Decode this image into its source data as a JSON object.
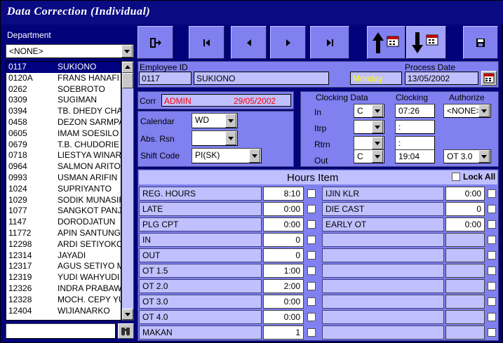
{
  "window": {
    "title": "Data Correction (Individual)"
  },
  "sidebar": {
    "department_label": "Department",
    "department_value": "<NONE>",
    "search_value": "",
    "employees": [
      {
        "id": "0117",
        "name": "SUKIONO"
      },
      {
        "id": "0120A",
        "name": "FRANS   HANAFI"
      },
      {
        "id": "0262",
        "name": "SOEBROTO"
      },
      {
        "id": "0309",
        "name": "SUGIMAN"
      },
      {
        "id": "0394",
        "name": "TB. DHEDY CHAN"
      },
      {
        "id": "0458",
        "name": "DEZON SARMPAE"
      },
      {
        "id": "0605",
        "name": "IMAM SOESILO"
      },
      {
        "id": "0679",
        "name": "T.B. CHUDORIE F"
      },
      {
        "id": "0718",
        "name": "LIESTYA WINAR"
      },
      {
        "id": "0964",
        "name": "SALMON ARITON"
      },
      {
        "id": "0993",
        "name": "USMAN ARIFIN"
      },
      {
        "id": "1024",
        "name": "SUPRIYANTO"
      },
      {
        "id": "1029",
        "name": "SODIK MUNASIR"
      },
      {
        "id": "1077",
        "name": "SANGKOT PANJA"
      },
      {
        "id": "1147",
        "name": "DORODJATUN"
      },
      {
        "id": "11772",
        "name": "APIN SANTUNG"
      },
      {
        "id": "12298",
        "name": "ARDI SETIYOKO"
      },
      {
        "id": "12314",
        "name": "JAYADI"
      },
      {
        "id": "12317",
        "name": "AGUS SETIYO M"
      },
      {
        "id": "12319",
        "name": "YUDI WAHYUDI"
      },
      {
        "id": "12326",
        "name": "INDRA PRABAWA"
      },
      {
        "id": "12328",
        "name": "MOCH. CEPY YU"
      },
      {
        "id": "12404",
        "name": "WIJIANARKO"
      }
    ]
  },
  "employee": {
    "id_label": "Employee ID",
    "id": "0117",
    "name": "SUKIONO",
    "day": "Monday",
    "process_date_label": "Process Date",
    "process_date": "13/05/2002"
  },
  "corr": {
    "label": "Corr",
    "user": "ADMIN",
    "date": "29/05/2002"
  },
  "schedule": {
    "calendar_label": "Calendar",
    "calendar_value": "WD",
    "abs_label": "Abs. Rsn",
    "abs_value": "",
    "shift_label": "Shift Code",
    "shift_value": "PI(SK)"
  },
  "clocking": {
    "data_label": "Clocking Data",
    "clocking_label": "Clocking",
    "authorize_label": "Authorize",
    "rows": [
      {
        "label": "In",
        "code": "C",
        "time": "07:26",
        "auth": "<NONE>"
      },
      {
        "label": "Itrp",
        "code": "",
        "time": ":",
        "auth": ""
      },
      {
        "label": "Rtrn",
        "code": "",
        "time": ":",
        "auth": ""
      },
      {
        "label": "Out",
        "code": "C",
        "time": "19:04",
        "auth": "OT 3.0"
      }
    ]
  },
  "hours": {
    "title": "Hours Item",
    "lock_all_label": "Lock All",
    "left": [
      {
        "label": "REG. HOURS",
        "value": "8:10"
      },
      {
        "label": "LATE",
        "value": "0:00"
      },
      {
        "label": "PLG CPT",
        "value": "0:00"
      },
      {
        "label": "IN",
        "value": "0"
      },
      {
        "label": "OUT",
        "value": "0"
      },
      {
        "label": "OT 1.5",
        "value": "1:00"
      },
      {
        "label": "OT 2.0",
        "value": "2:00"
      },
      {
        "label": "OT 3.0",
        "value": "0:00"
      },
      {
        "label": "OT 4.0",
        "value": "0:00"
      },
      {
        "label": "MAKAN",
        "value": "1"
      }
    ],
    "right": [
      {
        "label": "IJIN KLR",
        "value": "0:00"
      },
      {
        "label": "DIE CAST",
        "value": "0"
      },
      {
        "label": "EARLY OT",
        "value": "0:00"
      },
      {
        "label": "",
        "value": ""
      },
      {
        "label": "",
        "value": ""
      },
      {
        "label": "",
        "value": ""
      },
      {
        "label": "",
        "value": ""
      },
      {
        "label": "",
        "value": ""
      },
      {
        "label": "",
        "value": ""
      },
      {
        "label": "",
        "value": ""
      }
    ]
  },
  "colors": {
    "title_bg": "#0a0a82",
    "panel": "#8080f0",
    "field_lavender": "#c0c0ff",
    "corr_text": "#ff0000",
    "day_text": "#ffff00"
  }
}
